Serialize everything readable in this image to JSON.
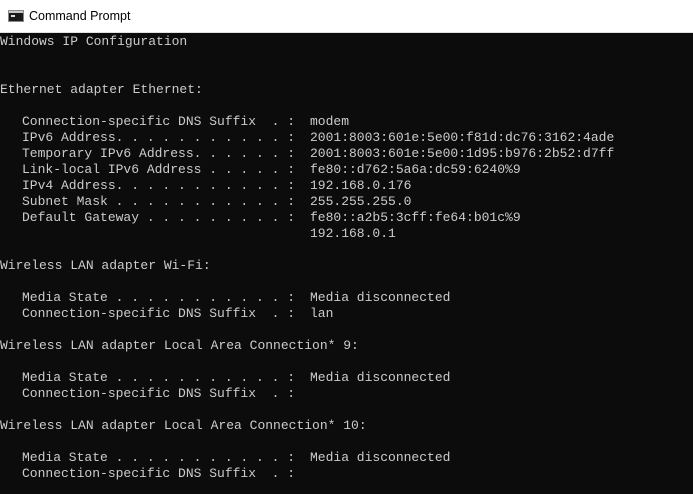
{
  "window": {
    "title": "Command Prompt"
  },
  "console": {
    "header": "Windows IP Configuration",
    "ethernet": {
      "heading": "Ethernet adapter Ethernet:",
      "entries": [
        {
          "label": "Connection-specific DNS Suffix  . :",
          "value": "modem"
        },
        {
          "label": "IPv6 Address. . . . . . . . . . . :",
          "value": "2001:8003:601e:5e00:f81d:dc76:3162:4ade"
        },
        {
          "label": "Temporary IPv6 Address. . . . . . :",
          "value": "2001:8003:601e:5e00:1d95:b976:2b52:d7ff"
        },
        {
          "label": "Link-local IPv6 Address . . . . . :",
          "value": "fe80::d762:5a6a:dc59:6240%9"
        },
        {
          "label": "IPv4 Address. . . . . . . . . . . :",
          "value": "192.168.0.176"
        },
        {
          "label": "Subnet Mask . . . . . . . . . . . :",
          "value": "255.255.255.0"
        },
        {
          "label": "Default Gateway . . . . . . . . . :",
          "value": "fe80::a2b5:3cff:fe64:b01c%9"
        }
      ],
      "gateway_extra": "192.168.0.1"
    },
    "wifi": {
      "heading": "Wireless LAN adapter Wi-Fi:",
      "entries": [
        {
          "label": "Media State . . . . . . . . . . . :",
          "value": "Media disconnected"
        },
        {
          "label": "Connection-specific DNS Suffix  . :",
          "value": "lan"
        }
      ]
    },
    "lac9": {
      "heading": "Wireless LAN adapter Local Area Connection* 9:",
      "entries": [
        {
          "label": "Media State . . . . . . . . . . . :",
          "value": "Media disconnected"
        },
        {
          "label": "Connection-specific DNS Suffix  . :",
          "value": ""
        }
      ]
    },
    "lac10": {
      "heading": "Wireless LAN adapter Local Area Connection* 10:",
      "entries": [
        {
          "label": "Media State . . . . . . . . . . . :",
          "value": "Media disconnected"
        },
        {
          "label": "Connection-specific DNS Suffix  . :",
          "value": ""
        }
      ]
    }
  }
}
